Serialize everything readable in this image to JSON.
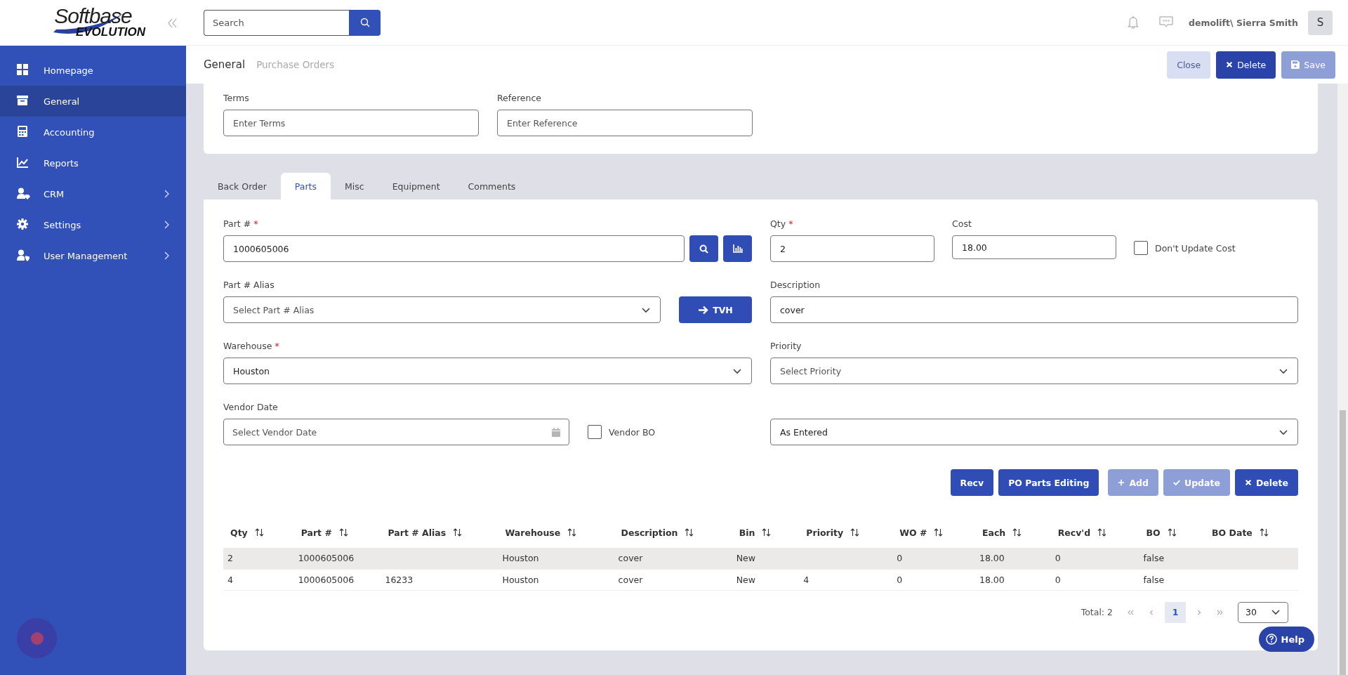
{
  "sidebar": {
    "logo": "Softbase",
    "logo_sub": "EVOLUTION",
    "items": [
      {
        "label": "Homepage",
        "selected": false,
        "has_children": false
      },
      {
        "label": "General",
        "selected": true,
        "has_children": false
      },
      {
        "label": "Accounting",
        "selected": false,
        "has_children": false
      },
      {
        "label": "Reports",
        "selected": false,
        "has_children": false
      },
      {
        "label": "CRM",
        "selected": false,
        "has_children": true
      },
      {
        "label": "Settings",
        "selected": false,
        "has_children": true
      },
      {
        "label": "User Management",
        "selected": false,
        "has_children": true
      }
    ]
  },
  "search": {
    "placeholder": "Search"
  },
  "user": {
    "name": "demolift\\ Sierra Smith",
    "initial": "S"
  },
  "breadcrumb": [
    {
      "label": "General",
      "selected": true
    },
    {
      "label": "Purchase Orders",
      "selected": false
    }
  ],
  "header_buttons": [
    {
      "label": "Close",
      "kind": "secondary",
      "disabled": false
    },
    {
      "label": "Delete",
      "kind": "delete",
      "disabled": false
    },
    {
      "label": "Save",
      "kind": "save",
      "disabled": true
    }
  ],
  "terms_fields": [
    {
      "label": "Terms",
      "placeholder": "Enter Terms"
    },
    {
      "label": "Reference",
      "placeholder": "Enter Reference"
    }
  ],
  "tabs": [
    {
      "label": "Back Order",
      "selected": false
    },
    {
      "label": "Parts",
      "selected": true
    },
    {
      "label": "Misc",
      "selected": false
    },
    {
      "label": "Equipment",
      "selected": false
    },
    {
      "label": "Comments",
      "selected": false
    }
  ],
  "parts_form": {
    "part_number": {
      "label": "Part #",
      "required_mark": "*",
      "value": "1000605006"
    },
    "qty": {
      "label": "Qty",
      "required_mark": "*",
      "value": "2"
    },
    "cost": {
      "label": "Cost",
      "value": "18.00"
    },
    "dont_update_cost": {
      "label": "Don't Update Cost",
      "checked": false
    },
    "part_alias": {
      "label": "Part # Alias",
      "placeholder": "Select Part # Alias"
    },
    "tvh_button": {
      "label": "TVH"
    },
    "description": {
      "label": "Description",
      "value": "cover"
    },
    "warehouse": {
      "label": "Warehouse",
      "required_mark": "*",
      "value": "Houston"
    },
    "priority": {
      "label": "Priority",
      "placeholder": "Select Priority"
    },
    "vendor_date": {
      "label": "Vendor Date",
      "placeholder": "Select Vendor Date"
    },
    "vendor_bo": {
      "label": "Vendor BO",
      "checked": false
    },
    "sort_order": {
      "value": "As Entered"
    }
  },
  "action_buttons": [
    {
      "label": "Recv",
      "kind": "plain",
      "disabled": false
    },
    {
      "label": "PO Parts Editing",
      "kind": "plain",
      "disabled": false
    },
    {
      "label": "Add",
      "kind": "add",
      "disabled": true
    },
    {
      "label": "Update",
      "kind": "update",
      "disabled": true
    },
    {
      "label": "Delete",
      "kind": "delete",
      "disabled": false
    }
  ],
  "table": {
    "columns": [
      "Qty",
      "Part #",
      "Part # Alias",
      "Warehouse",
      "Description",
      "Bin",
      "Priority",
      "WO #",
      "Each",
      "Recv'd",
      "BO",
      "BO Date"
    ],
    "rows": [
      {
        "selected": true,
        "cells": [
          "2",
          "1000605006",
          "",
          "Houston",
          "cover",
          "New",
          "",
          "0",
          "18.00",
          "0",
          "false",
          ""
        ]
      },
      {
        "selected": false,
        "cells": [
          "4",
          "1000605006",
          "16233",
          "Houston",
          "cover",
          "New",
          "4",
          "0",
          "18.00",
          "0",
          "false",
          ""
        ]
      }
    ]
  },
  "pagination": {
    "total": "Total: 2",
    "pages": [
      {
        "label": "1",
        "selected": true
      }
    ],
    "page_size": "30"
  },
  "help_button": {
    "label": "Help"
  }
}
